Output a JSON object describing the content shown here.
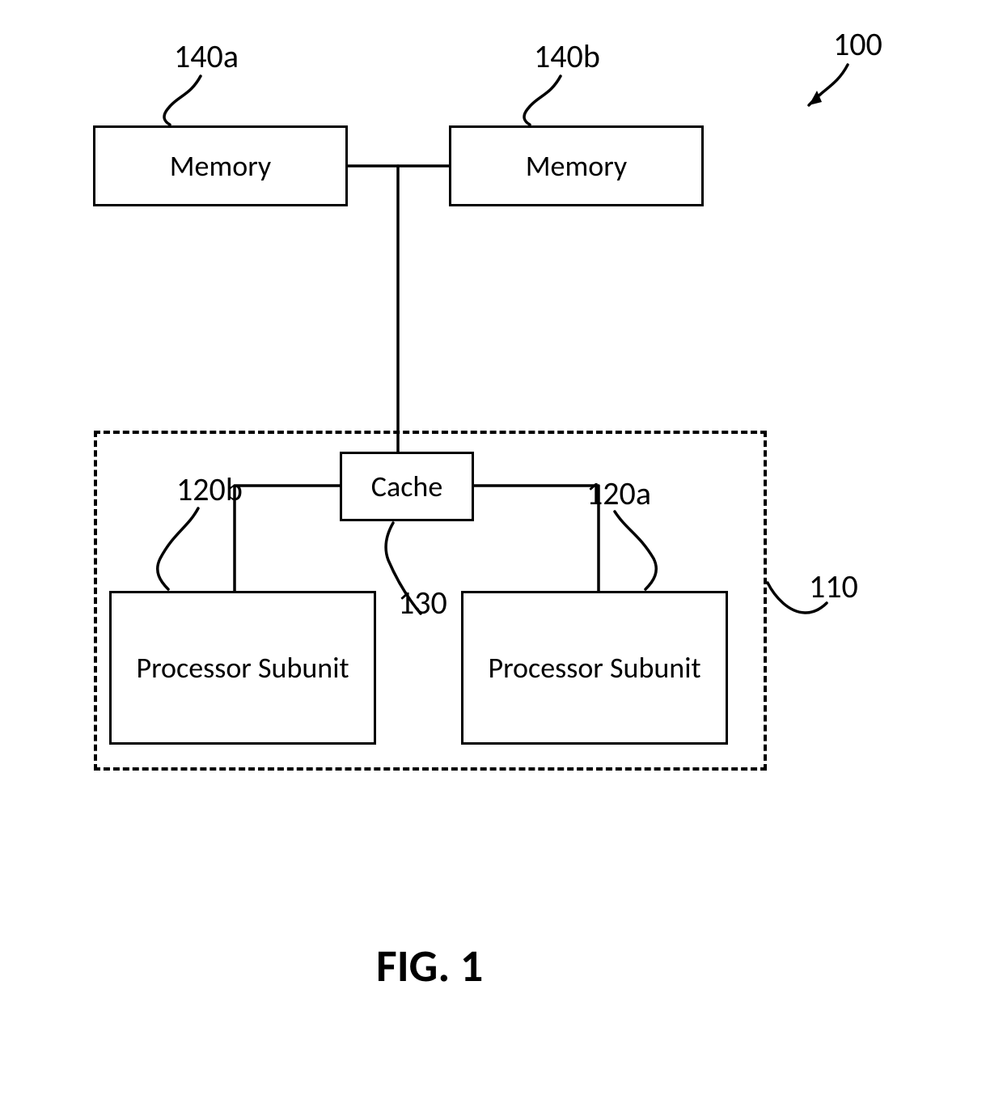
{
  "figure": {
    "caption": "FIG. 1",
    "system_ref": "100"
  },
  "memory": {
    "a": {
      "label": "Memory",
      "ref": "140a"
    },
    "b": {
      "label": "Memory",
      "ref": "140b"
    }
  },
  "processor_block": {
    "ref": "110",
    "cache": {
      "label": "Cache",
      "ref": "130"
    },
    "subunit_a": {
      "label": "Processor Subunit",
      "ref": "120a"
    },
    "subunit_b": {
      "label": "Processor Subunit",
      "ref": "120b"
    }
  }
}
